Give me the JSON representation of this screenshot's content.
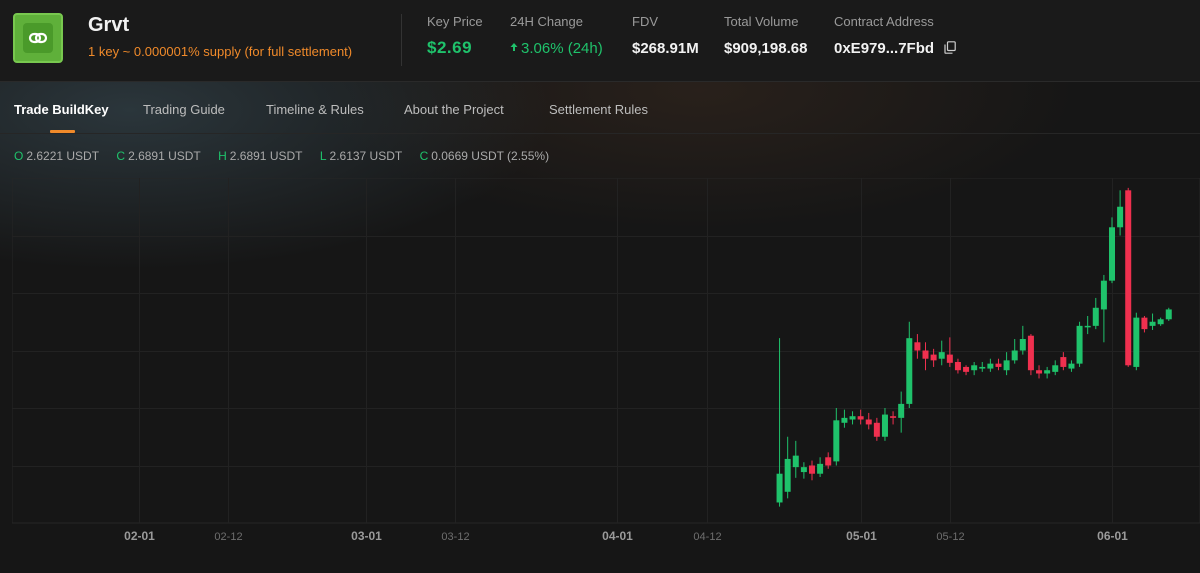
{
  "header": {
    "title": "Grvt",
    "subtitle": "1 key ~ 0.000001% supply (for full settlement)",
    "stats": {
      "key_price": {
        "label": "Key Price",
        "value": "$2.69"
      },
      "change_24h": {
        "label": "24H Change",
        "value": "3.06% (24h)"
      },
      "fdv": {
        "label": "FDV",
        "value": "$268.91M"
      },
      "total_volume": {
        "label": "Total Volume",
        "value": "$909,198.68"
      },
      "contract_address": {
        "label": "Contract Address",
        "value": "0xE979...7Fbd"
      }
    },
    "colors": {
      "logo": "#5fb03a",
      "accent": "#f08a2a",
      "up": "#1fc26b",
      "down": "#f0304f"
    },
    "icons": {
      "logo": "link-icon",
      "copy": "copy-icon",
      "change": "arrow-up-icon"
    }
  },
  "tabs": [
    {
      "label": "Trade BuildKey",
      "active": true
    },
    {
      "label": "Trading Guide",
      "active": false
    },
    {
      "label": "Timeline & Rules",
      "active": false
    },
    {
      "label": "About the Project",
      "active": false
    },
    {
      "label": "Settlement Rules",
      "active": false
    }
  ],
  "ohlc": {
    "open": {
      "key": "O",
      "value": "2.6221 USDT"
    },
    "close": {
      "key": "C",
      "value": "2.6891 USDT"
    },
    "high": {
      "key": "H",
      "value": "2.6891 USDT"
    },
    "low": {
      "key": "L",
      "value": "2.6137 USDT"
    },
    "change": {
      "key": "C",
      "value": "0.0669 USDT (2.55%)"
    }
  },
  "chart_data": {
    "type": "candlestick",
    "title": "",
    "xlabel": "",
    "ylabel": "",
    "x_ticks": [
      {
        "label": "02-01",
        "major": true
      },
      {
        "label": "02-12",
        "major": false
      },
      {
        "label": "03-01",
        "major": true
      },
      {
        "label": "03-12",
        "major": false
      },
      {
        "label": "04-01",
        "major": true
      },
      {
        "label": "04-12",
        "major": false
      },
      {
        "label": "05-01",
        "major": true
      },
      {
        "label": "05-12",
        "major": false
      },
      {
        "label": "06-01",
        "major": true
      }
    ],
    "grid": true,
    "price_axis_shown": false,
    "candles": [
      {
        "x": "04-21",
        "o": 1.25,
        "c": 1.6,
        "h": 3.25,
        "l": 1.2
      },
      {
        "x": "04-22",
        "o": 1.38,
        "c": 1.78,
        "h": 2.05,
        "l": 1.3
      },
      {
        "x": "04-23",
        "o": 1.68,
        "c": 1.82,
        "h": 2.0,
        "l": 1.55
      },
      {
        "x": "04-24",
        "o": 1.62,
        "c": 1.68,
        "h": 1.74,
        "l": 1.54
      },
      {
        "x": "04-25",
        "o": 1.7,
        "c": 1.6,
        "h": 1.76,
        "l": 1.52
      },
      {
        "x": "04-26",
        "o": 1.6,
        "c": 1.72,
        "h": 1.8,
        "l": 1.56
      },
      {
        "x": "04-27",
        "o": 1.8,
        "c": 1.7,
        "h": 1.86,
        "l": 1.66
      },
      {
        "x": "04-28",
        "o": 1.75,
        "c": 2.25,
        "h": 2.4,
        "l": 1.7
      },
      {
        "x": "04-29",
        "o": 2.22,
        "c": 2.28,
        "h": 2.38,
        "l": 2.16
      },
      {
        "x": "04-30",
        "o": 2.26,
        "c": 2.3,
        "h": 2.36,
        "l": 2.2
      },
      {
        "x": "05-01",
        "o": 2.3,
        "c": 2.26,
        "h": 2.38,
        "l": 2.2
      },
      {
        "x": "05-02",
        "o": 2.26,
        "c": 2.2,
        "h": 2.34,
        "l": 2.14
      },
      {
        "x": "05-03",
        "o": 2.22,
        "c": 2.05,
        "h": 2.28,
        "l": 2.0
      },
      {
        "x": "05-04",
        "o": 2.05,
        "c": 2.32,
        "h": 2.4,
        "l": 2.0
      },
      {
        "x": "05-05",
        "o": 2.3,
        "c": 2.28,
        "h": 2.36,
        "l": 2.2
      },
      {
        "x": "05-06",
        "o": 2.28,
        "c": 2.45,
        "h": 2.6,
        "l": 2.1
      },
      {
        "x": "05-07",
        "o": 2.45,
        "c": 3.25,
        "h": 3.45,
        "l": 2.4
      },
      {
        "x": "05-08",
        "o": 3.2,
        "c": 3.1,
        "h": 3.3,
        "l": 3.0
      },
      {
        "x": "05-09",
        "o": 3.1,
        "c": 3.0,
        "h": 3.2,
        "l": 2.86
      },
      {
        "x": "05-10",
        "o": 3.05,
        "c": 2.98,
        "h": 3.12,
        "l": 2.9
      },
      {
        "x": "05-11",
        "o": 3.0,
        "c": 3.08,
        "h": 3.22,
        "l": 2.92
      },
      {
        "x": "05-12",
        "o": 3.05,
        "c": 2.95,
        "h": 3.26,
        "l": 2.9
      },
      {
        "x": "05-13",
        "o": 2.96,
        "c": 2.86,
        "h": 3.0,
        "l": 2.82
      },
      {
        "x": "05-14",
        "o": 2.9,
        "c": 2.84,
        "h": 2.92,
        "l": 2.8
      },
      {
        "x": "05-15",
        "o": 2.86,
        "c": 2.92,
        "h": 2.96,
        "l": 2.8
      },
      {
        "x": "05-16",
        "o": 2.88,
        "c": 2.9,
        "h": 2.96,
        "l": 2.84
      },
      {
        "x": "05-17",
        "o": 2.88,
        "c": 2.94,
        "h": 3.0,
        "l": 2.84
      },
      {
        "x": "05-18",
        "o": 2.94,
        "c": 2.9,
        "h": 3.0,
        "l": 2.86
      },
      {
        "x": "05-19",
        "o": 2.86,
        "c": 2.98,
        "h": 3.08,
        "l": 2.8
      },
      {
        "x": "05-20",
        "o": 2.98,
        "c": 3.1,
        "h": 3.24,
        "l": 2.94
      },
      {
        "x": "05-21",
        "o": 3.1,
        "c": 3.24,
        "h": 3.4,
        "l": 3.05
      },
      {
        "x": "05-22",
        "o": 3.28,
        "c": 2.86,
        "h": 3.3,
        "l": 2.8
      },
      {
        "x": "05-23",
        "o": 2.86,
        "c": 2.82,
        "h": 2.92,
        "l": 2.76
      },
      {
        "x": "05-24",
        "o": 2.82,
        "c": 2.86,
        "h": 2.9,
        "l": 2.76
      },
      {
        "x": "05-25",
        "o": 2.84,
        "c": 2.92,
        "h": 2.98,
        "l": 2.8
      },
      {
        "x": "05-26",
        "o": 3.02,
        "c": 2.9,
        "h": 3.08,
        "l": 2.86
      },
      {
        "x": "05-27",
        "o": 2.88,
        "c": 2.94,
        "h": 2.98,
        "l": 2.84
      },
      {
        "x": "05-28",
        "o": 2.94,
        "c": 3.4,
        "h": 3.45,
        "l": 2.9
      },
      {
        "x": "05-29",
        "o": 3.4,
        "c": 3.4,
        "h": 3.52,
        "l": 3.3
      },
      {
        "x": "05-30",
        "o": 3.4,
        "c": 3.62,
        "h": 3.74,
        "l": 3.36
      },
      {
        "x": "05-31",
        "o": 3.6,
        "c": 3.95,
        "h": 4.02,
        "l": 3.2
      },
      {
        "x": "06-01",
        "o": 3.95,
        "c": 4.6,
        "h": 4.72,
        "l": 3.92
      },
      {
        "x": "06-02",
        "o": 4.6,
        "c": 4.85,
        "h": 5.05,
        "l": 4.5
      },
      {
        "x": "06-03",
        "o": 5.05,
        "c": 2.92,
        "h": 5.08,
        "l": 2.9
      },
      {
        "x": "06-04",
        "o": 2.9,
        "c": 3.5,
        "h": 3.56,
        "l": 2.86
      },
      {
        "x": "06-05",
        "o": 3.5,
        "c": 3.36,
        "h": 3.52,
        "l": 3.32
      },
      {
        "x": "06-06",
        "o": 3.4,
        "c": 3.45,
        "h": 3.55,
        "l": 3.35
      },
      {
        "x": "06-07",
        "o": 3.42,
        "c": 3.48,
        "h": 3.5,
        "l": 3.4
      },
      {
        "x": "06-08",
        "o": 3.48,
        "c": 3.6,
        "h": 3.62,
        "l": 3.46
      }
    ],
    "y_range": [
      1.0,
      5.2
    ]
  }
}
